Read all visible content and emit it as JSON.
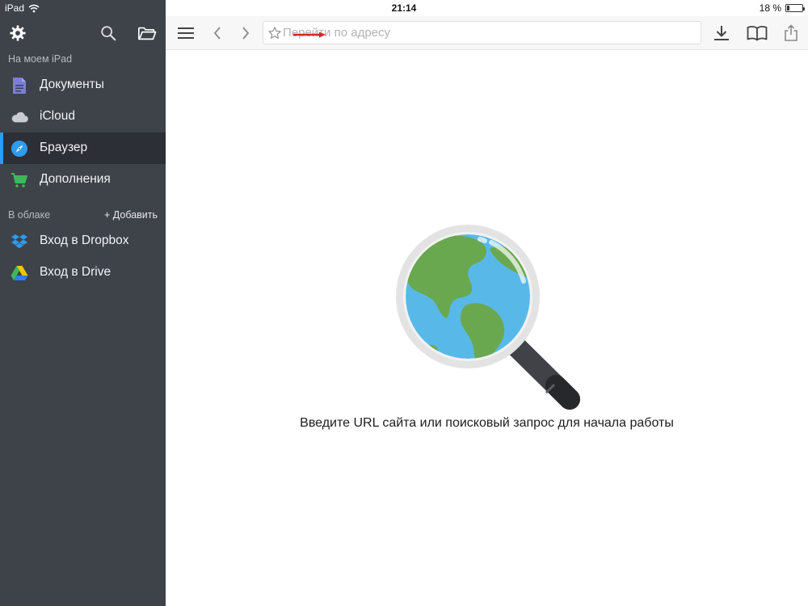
{
  "status_bar": {
    "device": "iPad",
    "time": "21:14",
    "battery": "18 %",
    "battery_level": 0.18
  },
  "sidebar": {
    "tools": [
      "gear-icon",
      "search-icon",
      "folder-icon"
    ],
    "local_section": "На моем iPad",
    "local_items": [
      {
        "label": "Документы",
        "icon": "document-icon",
        "color": "#7b7fd6"
      },
      {
        "label": "iCloud",
        "icon": "cloud-icon",
        "color": "#c9cbd0"
      },
      {
        "label": "Браузер",
        "icon": "compass-icon",
        "color": "#2d9bf0",
        "active": true
      },
      {
        "label": "Дополнения",
        "icon": "cart-icon",
        "color": "#3cb85b"
      }
    ],
    "cloud_section": "В облаке",
    "add_label": "+ Добавить",
    "cloud_items": [
      {
        "label": "Вход в Dropbox",
        "icon": "dropbox-icon",
        "color": "#2d9bf0"
      },
      {
        "label": "Вход в Drive",
        "icon": "drive-icon",
        "color": "#3cb85b"
      }
    ]
  },
  "toolbar": {
    "buttons": [
      "menu-icon",
      "back-icon",
      "forward-icon",
      "download-icon",
      "bookmarks-icon",
      "share-icon"
    ],
    "url_placeholder": "Перейти по адресу",
    "url_value": ""
  },
  "main": {
    "message": "Введите URL сайта или поисковый запрос для начала работы"
  },
  "colors": {
    "sidebar_bg": "#3e4249",
    "active_item_bg": "#2c2f35",
    "accent": "#2d9bf0",
    "arrow_annotation": "#d9252a"
  }
}
